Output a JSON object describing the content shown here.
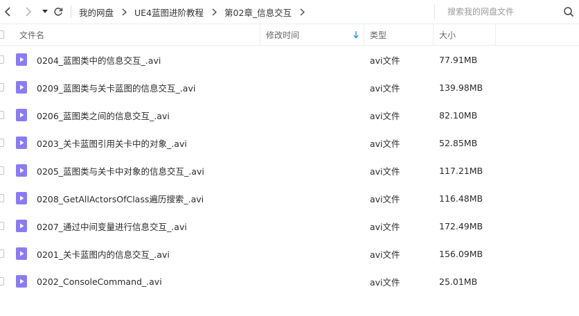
{
  "breadcrumb": [
    "我的网盘",
    "UE4蓝图进阶教程",
    "第02章_信息交互"
  ],
  "search": {
    "placeholder": "搜索我的网盘文件"
  },
  "columns": {
    "name": "文件名",
    "modified": "修改时间",
    "type": "类型",
    "size": "大小"
  },
  "files": [
    {
      "name": "0204_蓝图类中的信息交互_.avi",
      "type": "avi文件",
      "size": "77.91MB"
    },
    {
      "name": "0209_蓝图类与关卡蓝图的信息交互_.avi",
      "type": "avi文件",
      "size": "139.98MB"
    },
    {
      "name": "0206_蓝图类之间的信息交互_.avi",
      "type": "avi文件",
      "size": "82.10MB"
    },
    {
      "name": "0203_关卡蓝图引用关卡中的对象_.avi",
      "type": "avi文件",
      "size": "52.85MB"
    },
    {
      "name": "0205_蓝图类与关卡中对象的信息交互_.avi",
      "type": "avi文件",
      "size": "117.21MB"
    },
    {
      "name": "0208_GetAllActorsOfClass遍历搜索_.avi",
      "type": "avi文件",
      "size": "116.48MB"
    },
    {
      "name": "0207_通过中间变量进行信息交互_.avi",
      "type": "avi文件",
      "size": "172.49MB"
    },
    {
      "name": "0201_关卡蓝图内的信息交互_.avi",
      "type": "avi文件",
      "size": "156.09MB"
    },
    {
      "name": "0202_ConsoleCommand_.avi",
      "type": "avi文件",
      "size": "25.01MB"
    }
  ],
  "icons": {
    "back": "chevron-left-icon",
    "forward": "chevron-right-icon",
    "history": "caret-down-icon",
    "refresh": "refresh-icon",
    "search": "search-icon",
    "sort": "sort-down-arrow-icon",
    "file": "video-file-icon"
  },
  "colors": {
    "file_icon": "#8a7cf0",
    "sort_arrow": "#2f8ff0",
    "border": "#ededed"
  }
}
